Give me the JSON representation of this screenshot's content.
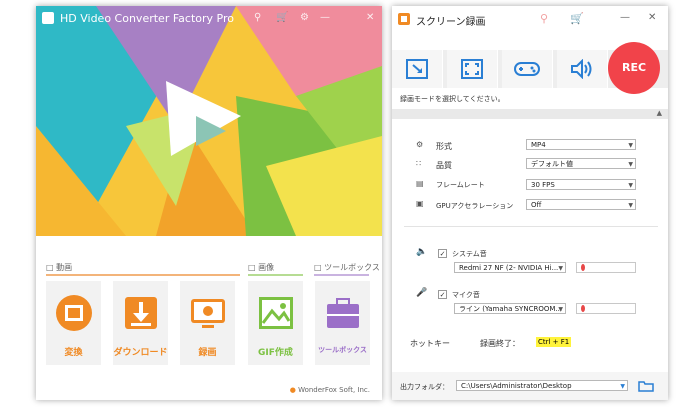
{
  "left_window": {
    "title": "HD Video Converter Factory Pro",
    "sections": {
      "video": "動画",
      "image": "画像",
      "toolbox": "ツールボックス"
    },
    "tiles": [
      {
        "label": "変換",
        "icon": "film-convert-icon",
        "color": "#f08a24"
      },
      {
        "label": "ダウンロード",
        "icon": "download-icon",
        "color": "#f08a24"
      },
      {
        "label": "録画",
        "icon": "screen-record-icon",
        "color": "#f08a24"
      },
      {
        "label": "GIF作成",
        "icon": "gif-image-icon",
        "color": "#7cc142"
      },
      {
        "label": "ツールボックス",
        "icon": "toolbox-icon",
        "color": "#9b6fc8"
      }
    ],
    "brand": "WonderFox Soft, Inc."
  },
  "right_window": {
    "title": "スクリーン録画",
    "rec_label": "REC",
    "mode_hint": "録画モードを選択してください。",
    "settings": [
      {
        "label": "形式",
        "value": "MP4"
      },
      {
        "label": "品質",
        "value": "デフォルト値"
      },
      {
        "label": "フレームレート",
        "value": "30 FPS"
      },
      {
        "label": "GPUアクセラレーション",
        "value": "Off"
      }
    ],
    "system_audio": {
      "label": "システム音",
      "device": "Redmi 27 NF (2- NVIDIA Hi..."
    },
    "mic_audio": {
      "label": "マイク音",
      "device": "ライン (Yamaha SYNCROOM..."
    },
    "hotkey_label": "ホットキー",
    "stop_label": "録画終了：",
    "stop_key": "Ctrl + F1",
    "output_label": "出力フォルダ：",
    "output_path": "C:\\Users\\Administrator\\Desktop"
  }
}
